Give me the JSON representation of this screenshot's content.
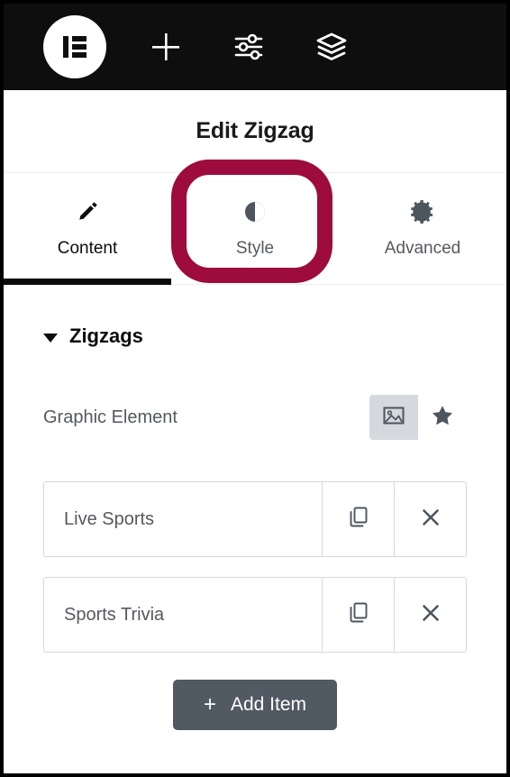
{
  "toolbar": {
    "logo": {
      "name": "elementor-logo",
      "label": "Elementor"
    },
    "buttons": [
      {
        "name": "add-element-icon",
        "label": "Add Element"
      },
      {
        "name": "settings-sliders-icon",
        "label": "Site Settings"
      },
      {
        "name": "layers-icon",
        "label": "Navigator"
      }
    ]
  },
  "header": {
    "title": "Edit Zigzag"
  },
  "tabs": [
    {
      "label": "Content",
      "icon": "pencil-icon",
      "active": true
    },
    {
      "label": "Style",
      "icon": "contrast-icon",
      "active": false
    },
    {
      "label": "Advanced",
      "icon": "gear-icon",
      "active": false
    }
  ],
  "annotation": {
    "target": "Style",
    "color": "#9e0b3d",
    "shape": "rounded-rectangle-outline"
  },
  "section": {
    "title": "Zigzags",
    "expanded": true,
    "caret": "caret-down-icon"
  },
  "controls": {
    "graphic_element": {
      "label": "Graphic Element",
      "options": [
        {
          "value": "image",
          "icon": "image-icon",
          "selected": true
        },
        {
          "value": "icon",
          "icon": "star-icon",
          "selected": false
        }
      ]
    }
  },
  "repeater": {
    "items": [
      {
        "title": "Live Sports",
        "duplicate_icon": "duplicate-icon",
        "remove_icon": "close-icon"
      },
      {
        "title": "Sports Trivia",
        "duplicate_icon": "duplicate-icon",
        "remove_icon": "close-icon"
      }
    ],
    "add_button": {
      "label": "Add Item",
      "icon": "plus-icon"
    }
  },
  "colors": {
    "toolbar_bg": "#0e0e0f",
    "accent_annotation": "#9e0b3d",
    "text_slate": "#54595f",
    "border_light": "#d5d8dd",
    "button_bg": "#515962",
    "selected_bg": "#d5d8dd"
  }
}
